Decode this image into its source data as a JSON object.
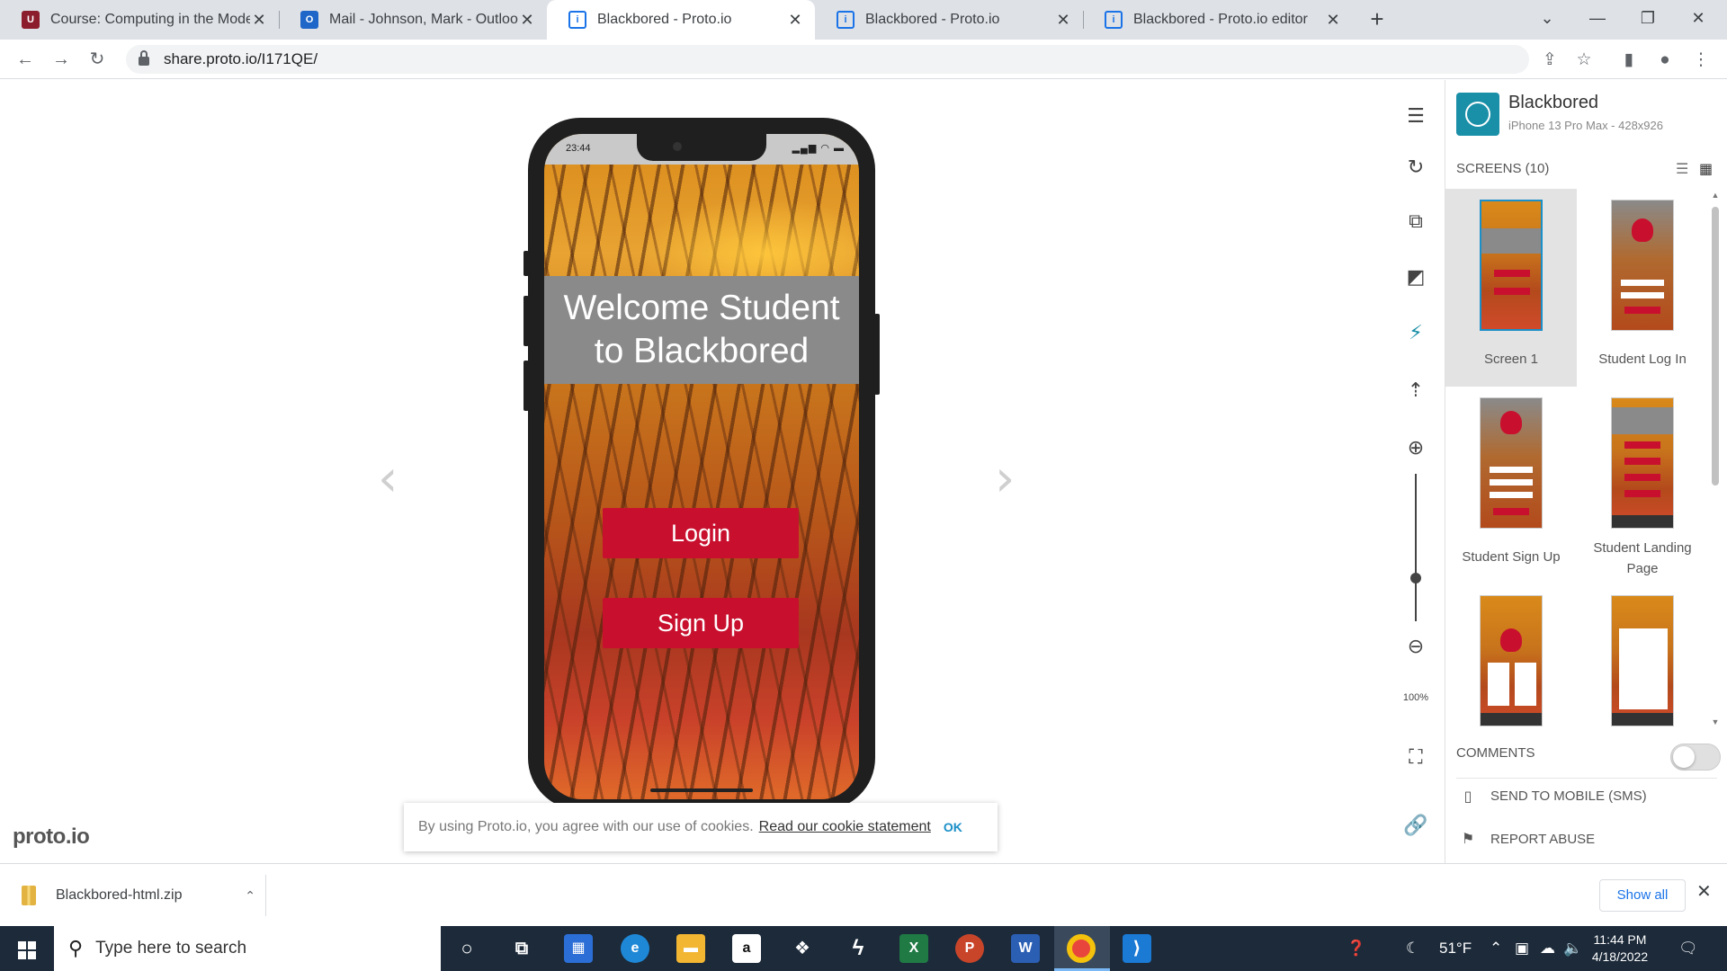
{
  "tabs": [
    {
      "title": "Course: Computing in the Modern",
      "favicon": "usc-favicon",
      "active": false
    },
    {
      "title": "Mail - Johnson, Mark - Outlook",
      "favicon": "outlook-favicon",
      "active": false
    },
    {
      "title": "Blackbored - Proto.io",
      "favicon": "protoio-favicon",
      "active": true
    },
    {
      "title": "Blackbored - Proto.io",
      "favicon": "protoio-favicon",
      "active": false
    },
    {
      "title": "Blackbored - Proto.io editor",
      "favicon": "protoio-favicon",
      "active": false
    }
  ],
  "address": {
    "url": "share.proto.io/I171QE/"
  },
  "phone": {
    "status_time": "23:44",
    "welcome_text": "Welcome Student to Blackbored",
    "login_label": "Login",
    "signup_label": "Sign Up"
  },
  "brand": "proto.io",
  "cookie": {
    "text": "By using Proto.io, you agree with our use of cookies.",
    "link": "Read our cookie statement",
    "ok": "OK"
  },
  "tools": {
    "zoom_level": "100%"
  },
  "panel": {
    "project_name": "Blackbored",
    "device": "iPhone 13 Pro Max - 428x926",
    "screens_header": "SCREENS (10)",
    "screens": [
      {
        "label": "Screen 1",
        "selected": true
      },
      {
        "label": "Student Log In",
        "selected": false
      },
      {
        "label": "Student Sign Up",
        "selected": false
      },
      {
        "label": "Student Landing Page",
        "selected": false
      },
      {
        "label": "",
        "selected": false
      },
      {
        "label": "",
        "selected": false
      }
    ],
    "comments_label": "COMMENTS",
    "comments_enabled": false,
    "send_mobile": "SEND TO MOBILE (SMS)",
    "report_abuse": "REPORT ABUSE"
  },
  "downloads": {
    "file": "Blackbored-html.zip",
    "show_all": "Show all"
  },
  "taskbar": {
    "search_placeholder": "Type here to search",
    "weather": "51°F",
    "time": "11:44 PM",
    "date": "4/18/2022"
  },
  "colors": {
    "accent": "#c8102e",
    "proto_teal": "#1a8fa8",
    "link_blue": "#1a73e8"
  }
}
